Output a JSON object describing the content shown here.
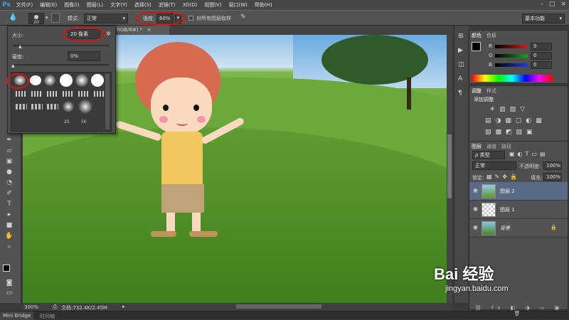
{
  "app": {
    "logo": "Ps"
  },
  "menu": [
    "文件(F)",
    "编辑(E)",
    "图像(I)",
    "图层(L)",
    "文字(Y)",
    "选择(S)",
    "滤镜(T)",
    "3D(D)",
    "视图(V)",
    "窗口(W)",
    "帮助(H)"
  ],
  "window_controls": [
    "–",
    "□",
    "×"
  ],
  "options": {
    "brush_size": "20",
    "mode_label": "模式:",
    "mode_value": "正常",
    "strength_label": "强度:",
    "strength_value": "60%",
    "sample_all_label": "对所有图层取样",
    "workspace": "基本功能"
  },
  "doc_tab": "RGB/8#) *",
  "brush_popup": {
    "size_label": "大小:",
    "size_value": "20 像素",
    "hardness_label": "硬度:",
    "hardness_value": "0%",
    "preset_numbers": [
      "25",
      "50"
    ]
  },
  "status": {
    "zoom": "300%",
    "doc_info": "文档:732.4K/2.45M"
  },
  "bottom_tabs": [
    "Mini Bridge",
    "时间轴"
  ],
  "color_panel": {
    "tabs": [
      "颜色",
      "色板"
    ],
    "channels": [
      {
        "label": "R",
        "value": "0"
      },
      {
        "label": "G",
        "value": "0"
      },
      {
        "label": "B",
        "value": "0"
      }
    ],
    "accent_colors": {
      "red": "#d11d1d",
      "green": "#1da01d",
      "blue": "#1d3fd1"
    }
  },
  "adjust_panel": {
    "tabs": [
      "调整",
      "样式"
    ],
    "title": "添加调整"
  },
  "layers_panel": {
    "tabs": [
      "图层",
      "通道",
      "路径"
    ],
    "kind_label": "ρ 类型",
    "blend_mode": "正常",
    "opacity_label": "不透明度:",
    "opacity_value": "100%",
    "lock_label": "锁定:",
    "fill_label": "填充:",
    "fill_value": "100%",
    "layers": [
      {
        "name": "图层 2",
        "selected": true
      },
      {
        "name": "图层 1",
        "selected": false
      },
      {
        "name": "背景",
        "selected": false
      }
    ]
  },
  "watermark": {
    "brand": "Bai 经验",
    "url": "jingyan.baidu.com"
  }
}
